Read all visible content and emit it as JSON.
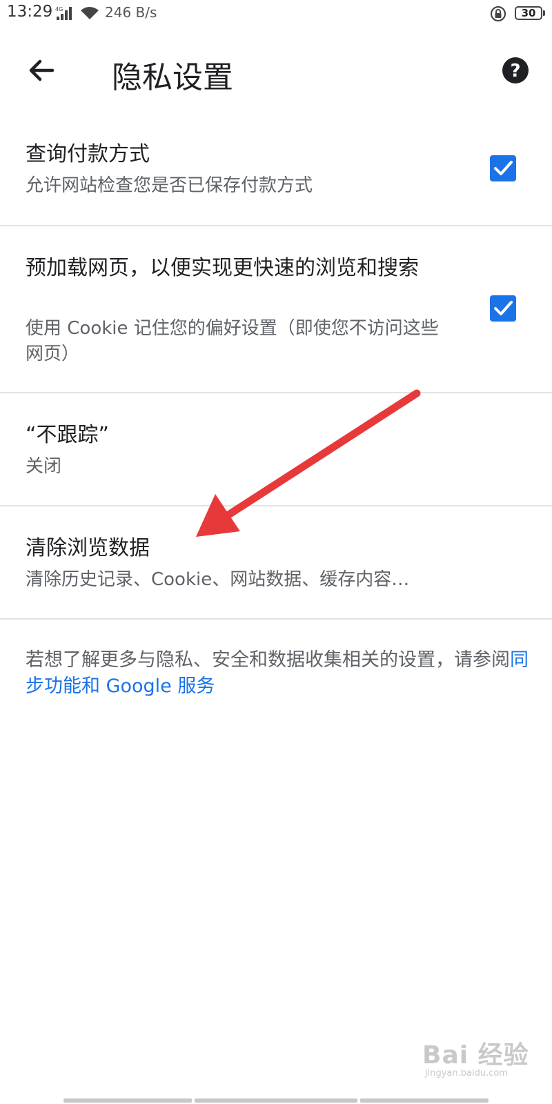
{
  "status_bar": {
    "time": "13:29",
    "network": "4G",
    "speed": "246 B/s",
    "battery": "30"
  },
  "toolbar": {
    "title": "隐私设置",
    "back_icon": "arrow-left-icon",
    "help_icon": "help-circle-icon"
  },
  "settings": [
    {
      "title": "查询付款方式",
      "subtitle": "允许网站检查您是否已保存付款方式",
      "checked": true
    },
    {
      "title": "预加载网页，以便实现更快速的浏览和搜索",
      "subtitle": "使用 Cookie 记住您的偏好设置（即使您不访问这些网页）",
      "checked": true
    },
    {
      "title": "“不跟踪”",
      "subtitle": "关闭"
    },
    {
      "title": "清除浏览数据",
      "subtitle": "清除历史记录、Cookie、网站数据、缓存内容…"
    }
  ],
  "footer": {
    "text": "若想了解更多与隐私、安全和数据收集相关的设置，请参阅",
    "link": "同步功能和 Google 服务"
  },
  "watermark": {
    "main": "Bai 经验",
    "sub": "jingyan.baidu.com"
  },
  "colors": {
    "accent": "#1a73e8",
    "annotation_arrow": "#e8393a"
  }
}
